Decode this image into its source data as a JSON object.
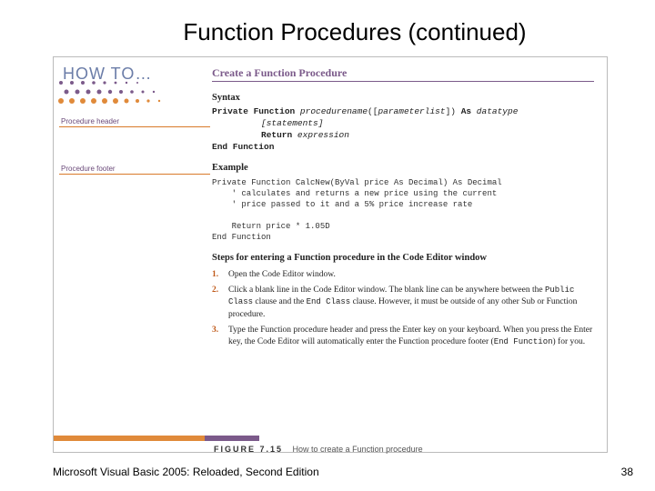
{
  "title": "Function Procedures (continued)",
  "howto": "HOW TO…",
  "fig_title": "Create a Function Procedure",
  "callouts": {
    "header": "Procedure header",
    "footer": "Procedure footer"
  },
  "syntax_heading": "Syntax",
  "syntax": {
    "line1_kw1": "Private Function",
    "line1_it1": "procedurename",
    "line1_plain1": "([",
    "line1_it2": "parameterlist",
    "line1_plain2": "])",
    "line1_kw2": "As",
    "line1_it3": "datatype",
    "line2_it": "[statements]",
    "line3_kw": "Return",
    "line3_it": "expression",
    "line4_kw": "End Function"
  },
  "example_heading": "Example",
  "example_code": "Private Function CalcNew(ByVal price As Decimal) As Decimal\n    ' calculates and returns a new price using the current\n    ' price passed to it and a 5% price increase rate\n\n    Return price * 1.05D\nEnd Function",
  "steps_heading": "Steps for entering a Function procedure in the Code Editor window",
  "steps": {
    "s1": "Open the Code Editor window.",
    "s2a": "Click a blank line in the Code Editor window. The blank line can be anywhere between the ",
    "s2b": "Public Class",
    "s2c": " clause and the ",
    "s2d": "End Class",
    "s2e": " clause. However, it must be outside of any other Sub or Function procedure.",
    "s3a": "Type the Function procedure header and press the Enter key on your keyboard. When you press the Enter key, the Code Editor will automatically enter the Function procedure footer (",
    "s3b": "End Function",
    "s3c": ") for you."
  },
  "fig_caption": {
    "num": "FIGURE 7.15",
    "text": "How to create a Function procedure"
  },
  "footer_left": "Microsoft Visual Basic 2005: Reloaded, Second Edition",
  "footer_right": "38"
}
